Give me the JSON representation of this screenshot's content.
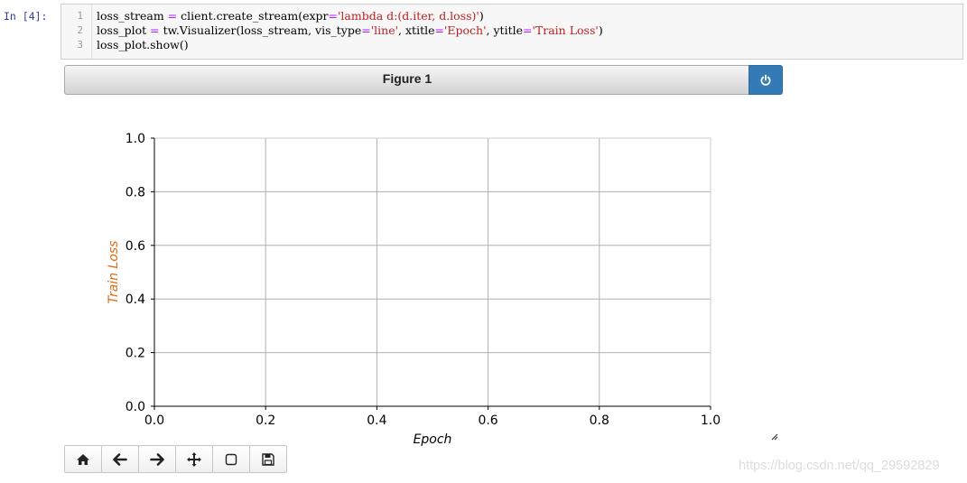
{
  "cell": {
    "prompt": "In  [4]:",
    "line_numbers": [
      "1",
      "2",
      "3"
    ],
    "lines": [
      {
        "a": "loss_stream ",
        "eq": "=",
        "b": " client.create_stream(expr",
        "eq2": "=",
        "s1": "'lambda d:(d.iter, d.loss)'",
        "c": ")"
      },
      {
        "a": "loss_plot ",
        "eq": "=",
        "b": " tw.Visualizer(loss_stream, vis_type",
        "eq2": "=",
        "s1": "'line'",
        "c": ", xtitle",
        "eq3": "=",
        "s2": "'Epoch'",
        "d": ", ytitle",
        "eq4": "=",
        "s3": "'Train Loss'",
        "e": ")"
      },
      {
        "a": "loss_plot.show()"
      }
    ]
  },
  "figure": {
    "title": "Figure 1",
    "power_icon": "power-icon"
  },
  "chart_data": {
    "type": "line",
    "x": [],
    "series": [],
    "xlabel": "Epoch",
    "ylabel": "Train Loss",
    "xlim": [
      0.0,
      1.0
    ],
    "ylim": [
      0.0,
      1.0
    ],
    "xticks": [
      "0.0",
      "0.2",
      "0.4",
      "0.6",
      "0.8",
      "1.0"
    ],
    "yticks": [
      "0.0",
      "0.2",
      "0.4",
      "0.6",
      "0.8",
      "1.0"
    ],
    "grid": true,
    "ylabel_color": "#e06c14"
  },
  "toolbar": {
    "buttons": [
      "home-icon",
      "back-arrow-icon",
      "forward-arrow-icon",
      "pan-icon",
      "zoom-rect-icon",
      "save-icon"
    ]
  },
  "watermark": "https://blog.csdn.net/qq_29592829"
}
